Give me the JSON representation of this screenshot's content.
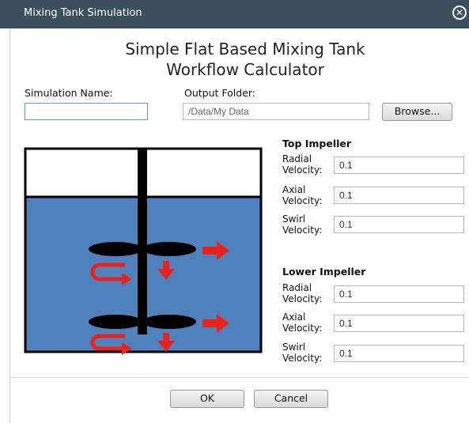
{
  "window": {
    "title": "Mixing Tank Simulation"
  },
  "heading": {
    "line1": "Simple Flat Based Mixing Tank",
    "line2": "Workflow Calculator"
  },
  "simulation_name": {
    "label": "Simulation Name:",
    "value": ""
  },
  "output_folder": {
    "label": "Output Folder:",
    "value": "/Data/My Data",
    "browse_label": "Browse..."
  },
  "top_impeller": {
    "title": "Top Impeller",
    "radial": {
      "label_line1": "Radial",
      "label_line2": "Velocity:",
      "value": "0.1"
    },
    "axial": {
      "label_line1": "Axial",
      "label_line2": "Velocity:",
      "value": "0.1"
    },
    "swirl": {
      "label_line1": "Swirl",
      "label_line2": "Velocity:",
      "value": "0.1"
    }
  },
  "lower_impeller": {
    "title": "Lower Impeller",
    "radial": {
      "label_line1": "Radial",
      "label_line2": "Velocity:",
      "value": "0.1"
    },
    "axial": {
      "label_line1": "Axial",
      "label_line2": "Velocity:",
      "value": "0.1"
    },
    "swirl": {
      "label_line1": "Swirl",
      "label_line2": "Velocity:",
      "value": "0.1"
    }
  },
  "buttons": {
    "ok": "OK",
    "cancel": "Cancel"
  },
  "colors": {
    "titlebar": "#3b4f5e",
    "liquid": "#4f81bd",
    "arrow": "#e8231e",
    "blade": "#000000"
  },
  "icons": {
    "close": "close-circle-icon"
  }
}
